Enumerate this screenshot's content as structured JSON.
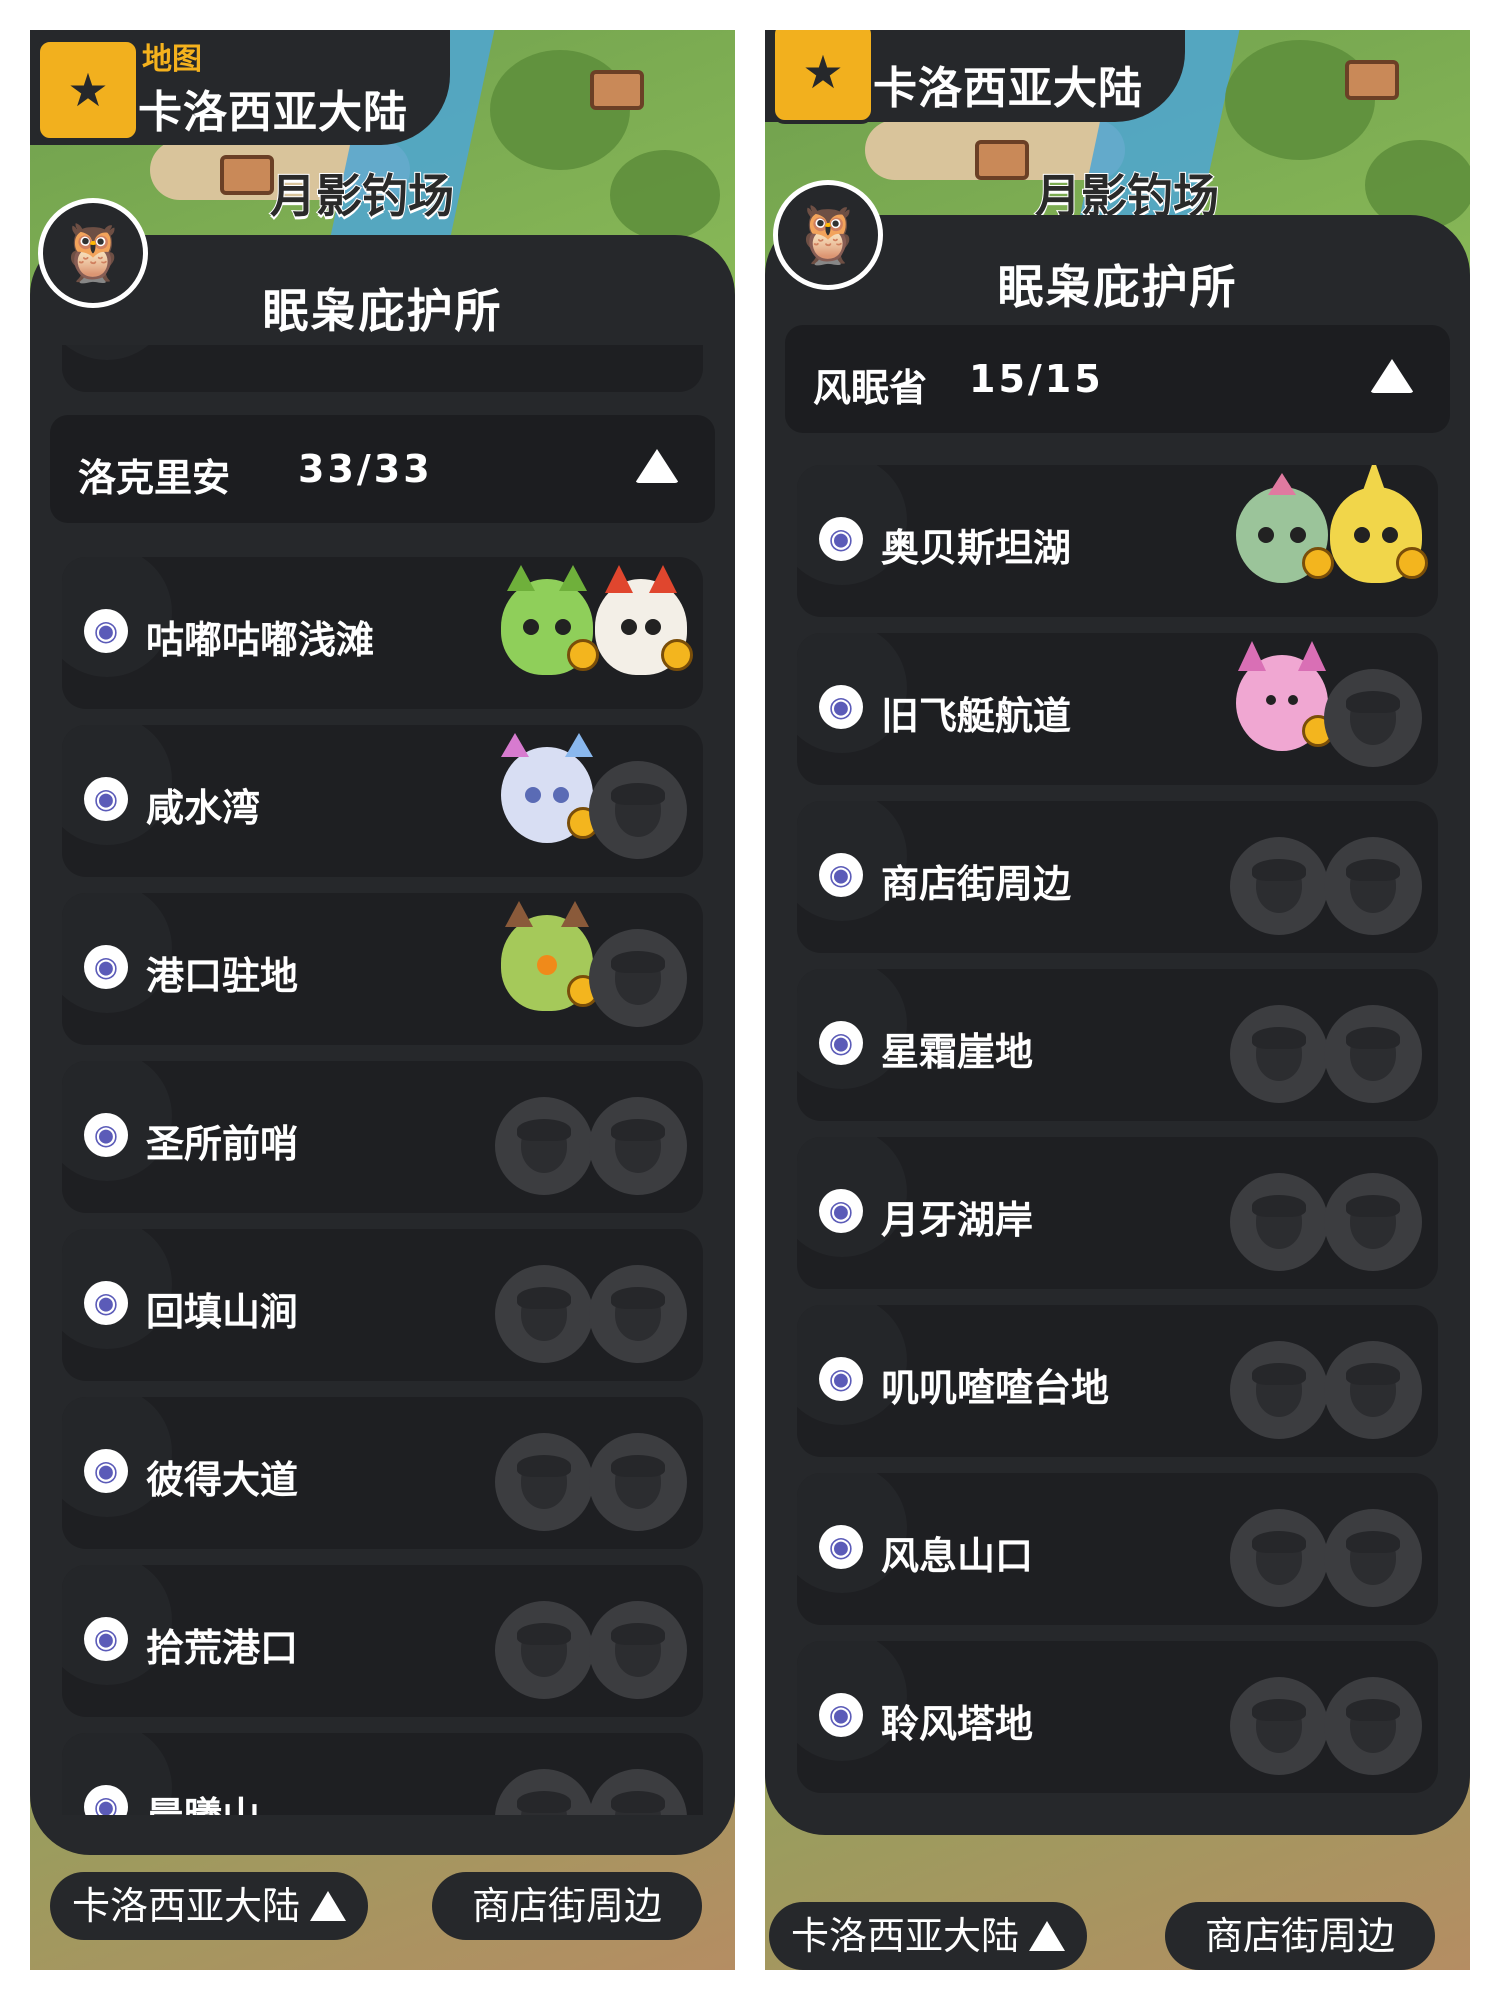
{
  "left": {
    "header": {
      "subtitle": "地图",
      "title": "卡洛西亚大陆"
    },
    "map_label": "月影钓场",
    "panel_title": "眠枭庇护所",
    "group": {
      "name": "洛克里安",
      "count": "33/33"
    },
    "rows": [
      {
        "label": "咕嘟咕嘟浅滩",
        "slots": [
          "green-cat-creature",
          "red-fox-creature"
        ]
      },
      {
        "label": "咸水湾",
        "slots": [
          "axolotl-creature",
          "empty"
        ]
      },
      {
        "label": "港口驻地",
        "slots": [
          "leaf-creature",
          "empty"
        ]
      },
      {
        "label": "圣所前哨",
        "slots": [
          "empty",
          "empty"
        ]
      },
      {
        "label": "回填山涧",
        "slots": [
          "empty",
          "empty"
        ]
      },
      {
        "label": "彼得大道",
        "slots": [
          "empty",
          "empty"
        ]
      },
      {
        "label": "拾荒港口",
        "slots": [
          "empty",
          "empty"
        ]
      },
      {
        "label": "晨曦山",
        "slots": [
          "empty",
          "empty"
        ]
      }
    ],
    "bottom": {
      "region": "卡洛西亚大陆",
      "location": "商店街周边"
    }
  },
  "right": {
    "header": {
      "title": "卡洛西亚大陆"
    },
    "map_label": "月影钓场",
    "panel_title": "眠枭庇护所",
    "group": {
      "name": "风眠省",
      "count": "15/15"
    },
    "rows": [
      {
        "label": "奥贝斯坦湖",
        "slots": [
          "sprout-bird-creature",
          "yellow-horn-creature"
        ]
      },
      {
        "label": "旧飞艇航道",
        "slots": [
          "pink-blossom-creature",
          "empty"
        ]
      },
      {
        "label": "商店街周边",
        "slots": [
          "empty",
          "empty"
        ]
      },
      {
        "label": "星霜崖地",
        "slots": [
          "empty",
          "empty"
        ]
      },
      {
        "label": "月牙湖岸",
        "slots": [
          "empty",
          "empty"
        ]
      },
      {
        "label": "叽叽喳喳台地",
        "slots": [
          "empty",
          "empty"
        ]
      },
      {
        "label": "风息山口",
        "slots": [
          "empty",
          "empty"
        ]
      },
      {
        "label": "聆风塔地",
        "slots": [
          "empty",
          "empty"
        ]
      }
    ],
    "bottom": {
      "region": "卡洛西亚大陆",
      "location": "商店街周边"
    }
  },
  "colors": {
    "panel": "#26282b",
    "row": "#1e1f22",
    "accent": "#f5b21d"
  }
}
